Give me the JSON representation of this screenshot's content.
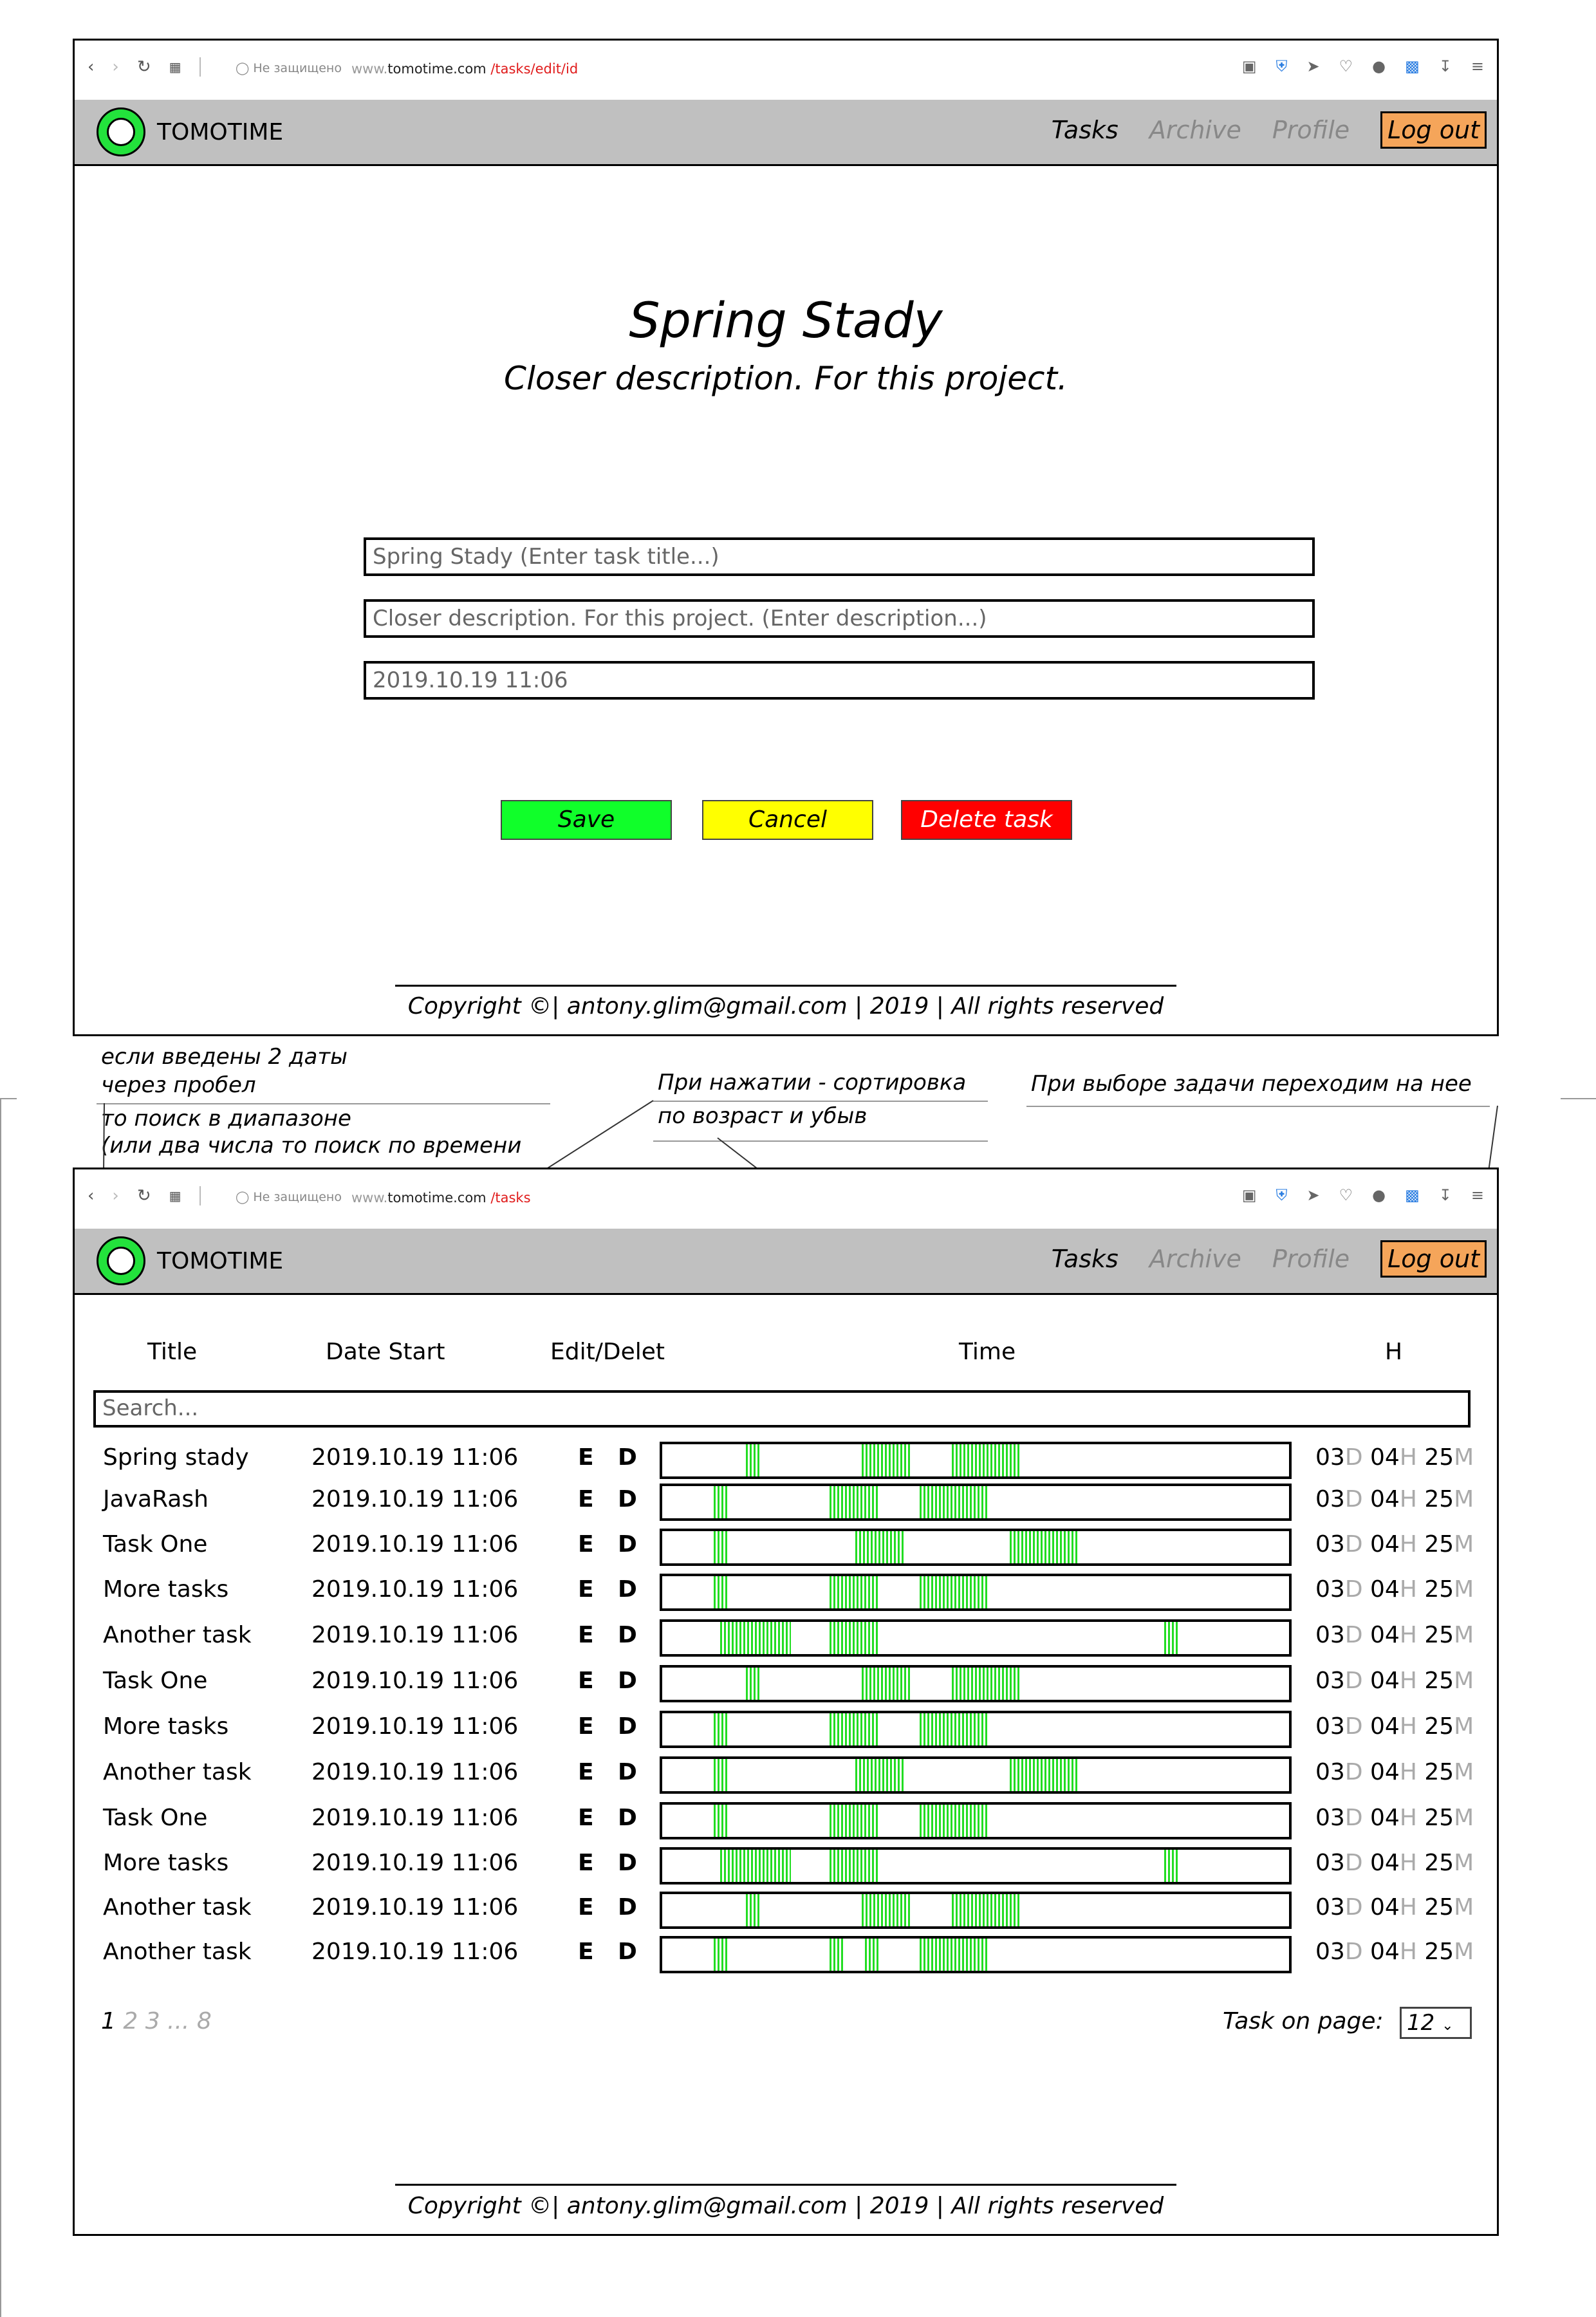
{
  "browser_top": {
    "secure_label": "Не защищено",
    "url_www": "www.",
    "url_host": "tomotime.com",
    "url_path": " /tasks/edit/id"
  },
  "browser_bottom": {
    "secure_label": "Не защищено",
    "url_www": "www.",
    "url_host": "tomotime.com",
    "url_path": " /tasks"
  },
  "header": {
    "brand": "TOMOTIME",
    "nav": {
      "tasks": "Tasks",
      "archive": "Archive",
      "profile": "Profile",
      "logout": "Log out"
    }
  },
  "edit": {
    "title": "Spring Stady",
    "description": "Closer description. For this project.",
    "title_field": "Spring Stady (Enter task title...)",
    "description_field": "Closer description. For this project. (Enter description...)",
    "date_field": "2019.10.19 11:06",
    "save": "Save",
    "cancel": "Cancel",
    "delete": "Delete task"
  },
  "footer": "Copyright ©| antony.glim@gmail.com | 2019 | All rights reserved",
  "annotations": {
    "left_1": "если введены 2 даты",
    "left_2": "через пробел",
    "left_3": "то поиск в диапазоне",
    "left_4": "(или два числа то поиск по времени",
    "mid_1": "При нажатии - сортировка",
    "mid_2": "по возраст и убыв",
    "right_1": "При выборе задачи переходим на нее"
  },
  "table": {
    "headers": {
      "title": "Title",
      "date": "Date Start",
      "edit": "Edit/Delet",
      "time": "Time",
      "h": "H"
    },
    "search_placeholder": "Search...",
    "edit_label": "E",
    "delete_label": "D",
    "units": {
      "d": "D",
      "h": "H",
      "m": "M"
    },
    "rows": [
      {
        "title": "Spring stady",
        "date": "2019.10.19 11:06",
        "d": "03",
        "h": "04",
        "m": "25"
      },
      {
        "title": "JavaRash",
        "date": "2019.10.19 11:06",
        "d": "03",
        "h": "04",
        "m": "25"
      },
      {
        "title": "Task One",
        "date": "2019.10.19 11:06",
        "d": "03",
        "h": "04",
        "m": "25"
      },
      {
        "title": "More tasks",
        "date": "2019.10.19 11:06",
        "d": "03",
        "h": "04",
        "m": "25"
      },
      {
        "title": "Another task",
        "date": "2019.10.19 11:06",
        "d": "03",
        "h": "04",
        "m": "25"
      },
      {
        "title": "Task One",
        "date": "2019.10.19 11:06",
        "d": "03",
        "h": "04",
        "m": "25"
      },
      {
        "title": "More tasks",
        "date": "2019.10.19 11:06",
        "d": "03",
        "h": "04",
        "m": "25"
      },
      {
        "title": "Another task",
        "date": "2019.10.19 11:06",
        "d": "03",
        "h": "04",
        "m": "25"
      },
      {
        "title": "Task One",
        "date": "2019.10.19 11:06",
        "d": "03",
        "h": "04",
        "m": "25"
      },
      {
        "title": "More tasks",
        "date": "2019.10.19 11:06",
        "d": "03",
        "h": "04",
        "m": "25"
      },
      {
        "title": "Another task",
        "date": "2019.10.19 11:06",
        "d": "03",
        "h": "04",
        "m": "25"
      },
      {
        "title": "Another task",
        "date": "2019.10.19 11:06",
        "d": "03",
        "h": "04",
        "m": "25"
      }
    ]
  },
  "pagination": {
    "current": "1",
    "others": " 2 3 ... 8"
  },
  "tasks_per_page": {
    "label": "Task on page:",
    "value": "12"
  },
  "colors": {
    "header_bg": "#c0c0c0",
    "logout_bg": "#f5a55a",
    "save": "#10ff2a",
    "cancel": "#ffff00",
    "delete": "#ff0000",
    "time_fill": "#22dd22",
    "url_path": "#e01b1b"
  }
}
